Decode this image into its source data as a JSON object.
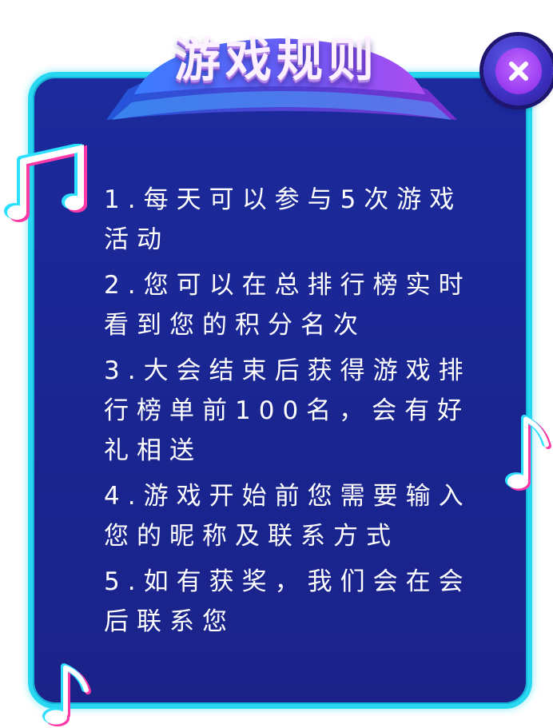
{
  "title": "游戏规则",
  "close_icon": "close-icon",
  "rules": [
    "1.每天可以参与5次游戏活动",
    "2.您可以在总排行榜实时看到您的积分名次",
    "3.大会结束后获得游戏排行榜单前100名，会有好礼相送",
    "4.游戏开始前您需要输入您的昵称及联系方式",
    "5.如有获奖，我们会在会后联系您"
  ],
  "decorations": [
    "music-note-icon",
    "music-note-icon",
    "music-note-icon"
  ],
  "colors": {
    "panel": "#1c2a9c",
    "border": "#27d8f0",
    "ribbon_left": "#3b78ff",
    "ribbon_right": "#a84cf0",
    "close_outer": "#3d2fbf",
    "close_inner": "#9a3bf0",
    "text": "#ffffff"
  }
}
